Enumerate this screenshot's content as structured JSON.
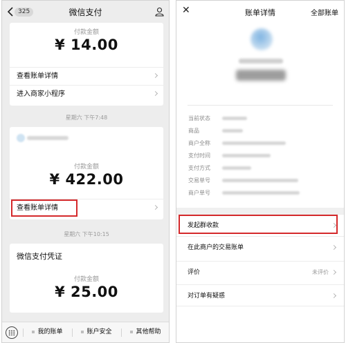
{
  "left": {
    "nav": {
      "badge": "325",
      "title": "微信支付",
      "back_icon": "chevron-left-icon",
      "person_icon": "person-icon"
    },
    "card1": {
      "label": "付款金额",
      "amount": "¥ 14.00",
      "rows": [
        "查看账单详情",
        "进入商家小程序"
      ]
    },
    "timestamp1": "星期六 下午7:48",
    "card2": {
      "label": "付款金额",
      "amount": "¥ 422.00",
      "row": "查看账单详情"
    },
    "timestamp2": "星期六 下午10:15",
    "card3": {
      "title": "微信支付凭证",
      "label": "付款金额",
      "amount": "¥ 25.00"
    },
    "tabbar": {
      "tabs": [
        "我的账单",
        "账户安全",
        "其他帮助"
      ],
      "keyboard_icon": "keyboard-icon"
    }
  },
  "right": {
    "nav": {
      "close": "✕",
      "title": "账单详情",
      "all": "全部账单"
    },
    "fields": [
      "当前状态",
      "商品",
      "商户全称",
      "支付时间",
      "支付方式",
      "交易单号",
      "商户单号"
    ],
    "actions": [
      {
        "label": "发起群收款",
        "side": ""
      },
      {
        "label": "在此商户的交易账单",
        "side": ""
      },
      {
        "label": "评价",
        "side": "未评价"
      },
      {
        "label": "对订单有疑惑",
        "side": ""
      }
    ]
  },
  "colors": {
    "highlight": "#d4282a",
    "left_bg": "#ededed"
  }
}
